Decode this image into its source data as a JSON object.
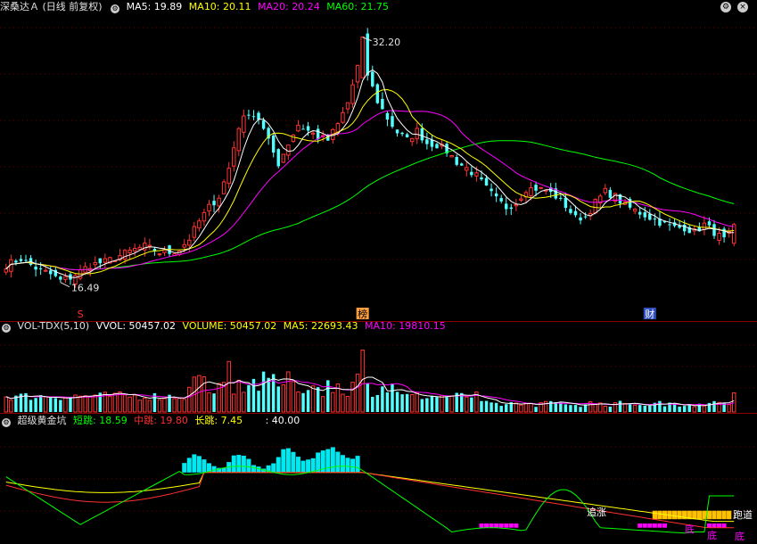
{
  "main": {
    "title": "深桑达Ａ (日线 前复权)",
    "ma_labels": [
      {
        "text": "MA5: 19.89",
        "color": "#ffffff"
      },
      {
        "text": "MA10: 20.11",
        "color": "#ffff00"
      },
      {
        "text": "MA20: 20.24",
        "color": "#ff00ff"
      },
      {
        "text": "MA60: 21.75",
        "color": "#00ff00"
      }
    ],
    "high_label": "32.20",
    "low_label": "16.49",
    "event_markers": [
      {
        "text": "S",
        "color": "#ff3030",
        "bg": ""
      },
      {
        "text": "榜",
        "color": "#000000",
        "bg": "#ffa040"
      },
      {
        "text": "财",
        "color": "#ffffff",
        "bg": "#3050c0"
      }
    ],
    "window_buttons": [
      "gear-icon",
      "close-icon"
    ]
  },
  "volume": {
    "title": "VOL-TDX(5,10)",
    "labels": [
      {
        "text": "VVOL: 50457.02",
        "color": "#ffffff"
      },
      {
        "text": "VOLUME: 50457.02",
        "color": "#ffff00"
      },
      {
        "text": "MA5: 22693.43",
        "color": "#ffff00"
      },
      {
        "text": "MA10: 19810.15",
        "color": "#ff00ff"
      }
    ]
  },
  "indicator": {
    "title": "超级黄金坑",
    "labels": [
      {
        "text": "短跳: 18.59",
        "color": "#00ff00"
      },
      {
        "text": "中跳: 19.80",
        "color": "#ff3030"
      },
      {
        "text": "长跳: 7.45",
        "color": "#ffff00"
      },
      {
        "text": ": 40.00",
        "color": "#ffffff"
      }
    ],
    "signal_texts": [
      {
        "text": "追涨",
        "color": "#ffffff"
      },
      {
        "text": "跑道",
        "color": "#ffffff"
      },
      {
        "text": "底",
        "color": "#ff00ff"
      },
      {
        "text": "底",
        "color": "#ff00ff"
      },
      {
        "text": "底",
        "color": "#ff00ff"
      }
    ]
  },
  "colors": {
    "up": "#ff3333",
    "down": "#54ffff",
    "grid": "#6b0000",
    "ma5": "#ffffff",
    "ma10": "#ffff00",
    "ma20": "#ff00ff",
    "ma60": "#00ff00",
    "indicator_bar": "#00e8f0",
    "gold_bar": "#ffc000",
    "pink_bar": "#ff00ff"
  },
  "chart_data": {
    "type": "candlestick",
    "price_anchors": [
      [
        0,
        17.6
      ],
      [
        3,
        18.0
      ],
      [
        6,
        17.4
      ],
      [
        9,
        17.0
      ],
      [
        11,
        16.6
      ],
      [
        13,
        16.8
      ],
      [
        15,
        17.2
      ],
      [
        17,
        17.6
      ],
      [
        20,
        17.8
      ],
      [
        23,
        18.2
      ],
      [
        26,
        18.6
      ],
      [
        28,
        18.8
      ],
      [
        31,
        18.4
      ],
      [
        33,
        18.4
      ],
      [
        35,
        18.6
      ],
      [
        37,
        19.3
      ],
      [
        39,
        20.4
      ],
      [
        41,
        21.3
      ],
      [
        43,
        22.0
      ],
      [
        45,
        23.8
      ],
      [
        47,
        26.5
      ],
      [
        49,
        27.4
      ],
      [
        51,
        27.0
      ],
      [
        53,
        25.5
      ],
      [
        55,
        24.1
      ],
      [
        57,
        25.4
      ],
      [
        59,
        26.6
      ],
      [
        61,
        26.2
      ],
      [
        63,
        25.8
      ],
      [
        65,
        25.6
      ],
      [
        67,
        26.6
      ],
      [
        69,
        28.0
      ],
      [
        71,
        30.3
      ],
      [
        72,
        32.0
      ],
      [
        73,
        29.8
      ],
      [
        75,
        28.1
      ],
      [
        77,
        27.0
      ],
      [
        79,
        26.1
      ],
      [
        81,
        25.6
      ],
      [
        83,
        26.2
      ],
      [
        85,
        25.4
      ],
      [
        87,
        25.3
      ],
      [
        89,
        24.9
      ],
      [
        91,
        24.2
      ],
      [
        93,
        23.8
      ],
      [
        95,
        23.3
      ],
      [
        97,
        22.5
      ],
      [
        99,
        21.8
      ],
      [
        101,
        21.3
      ],
      [
        103,
        21.6
      ],
      [
        105,
        22.5
      ],
      [
        107,
        22.5
      ],
      [
        109,
        22.4
      ],
      [
        111,
        22.0
      ],
      [
        113,
        21.4
      ],
      [
        115,
        20.6
      ],
      [
        117,
        20.7
      ],
      [
        119,
        21.6
      ],
      [
        121,
        22.3
      ],
      [
        123,
        22.0
      ],
      [
        125,
        21.4
      ],
      [
        127,
        21.1
      ],
      [
        129,
        20.8
      ],
      [
        131,
        20.5
      ],
      [
        133,
        20.2
      ],
      [
        135,
        20.0
      ],
      [
        137,
        20.0
      ],
      [
        139,
        19.7
      ],
      [
        141,
        20.2
      ],
      [
        143,
        19.7
      ],
      [
        145,
        19.2
      ],
      [
        146,
        19.5
      ],
      [
        147,
        20.2
      ]
    ],
    "price_range": [
      15.5,
      33.5
    ],
    "volume_range": [
      0,
      55000
    ],
    "last_volume": 50457.02
  }
}
